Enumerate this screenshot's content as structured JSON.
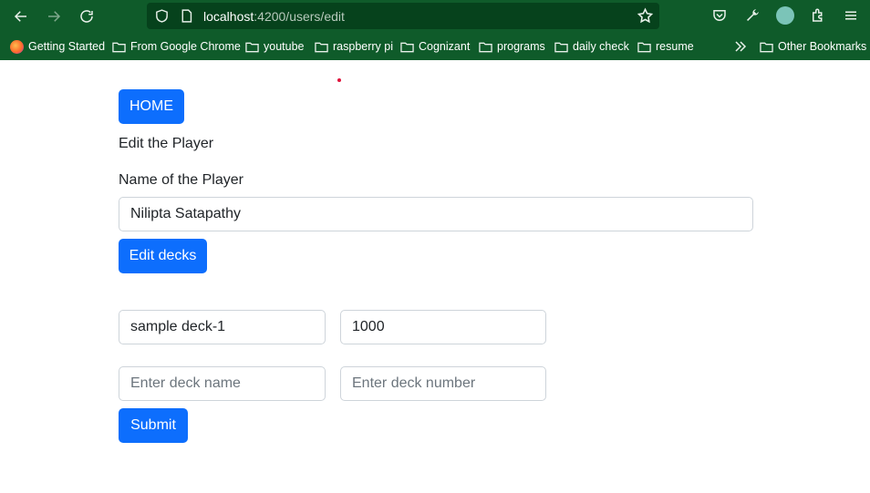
{
  "browser": {
    "url_host": "localhost",
    "url_rest": ":4200/users/edit",
    "bookmarks": [
      {
        "label": "Getting Started",
        "icon": "firefox-icon"
      },
      {
        "label": "From Google Chrome",
        "icon": "folder-icon"
      },
      {
        "label": "youtube",
        "icon": "folder-icon"
      },
      {
        "label": "raspberry pi",
        "icon": "folder-icon"
      },
      {
        "label": "Cognizant",
        "icon": "folder-icon"
      },
      {
        "label": "programs",
        "icon": "folder-icon"
      },
      {
        "label": "daily check",
        "icon": "folder-icon"
      },
      {
        "label": "resume",
        "icon": "folder-icon"
      },
      {
        "label": "Other Bookmarks",
        "icon": "folder-icon"
      }
    ]
  },
  "page": {
    "home_label": "HOME",
    "heading": "Edit the Player",
    "name_label": "Name of the Player",
    "name_value": "Nilipta Satapathy",
    "edit_decks_label": "Edit decks",
    "deck_rows": [
      {
        "name": "sample deck-1",
        "number": "1000"
      }
    ],
    "new_deck_name_placeholder": "Enter deck name",
    "new_deck_number_placeholder": "Enter deck number",
    "submit_label": "Submit"
  },
  "colors": {
    "chrome": "#0f5b2a",
    "primary": "#0d6efd"
  }
}
